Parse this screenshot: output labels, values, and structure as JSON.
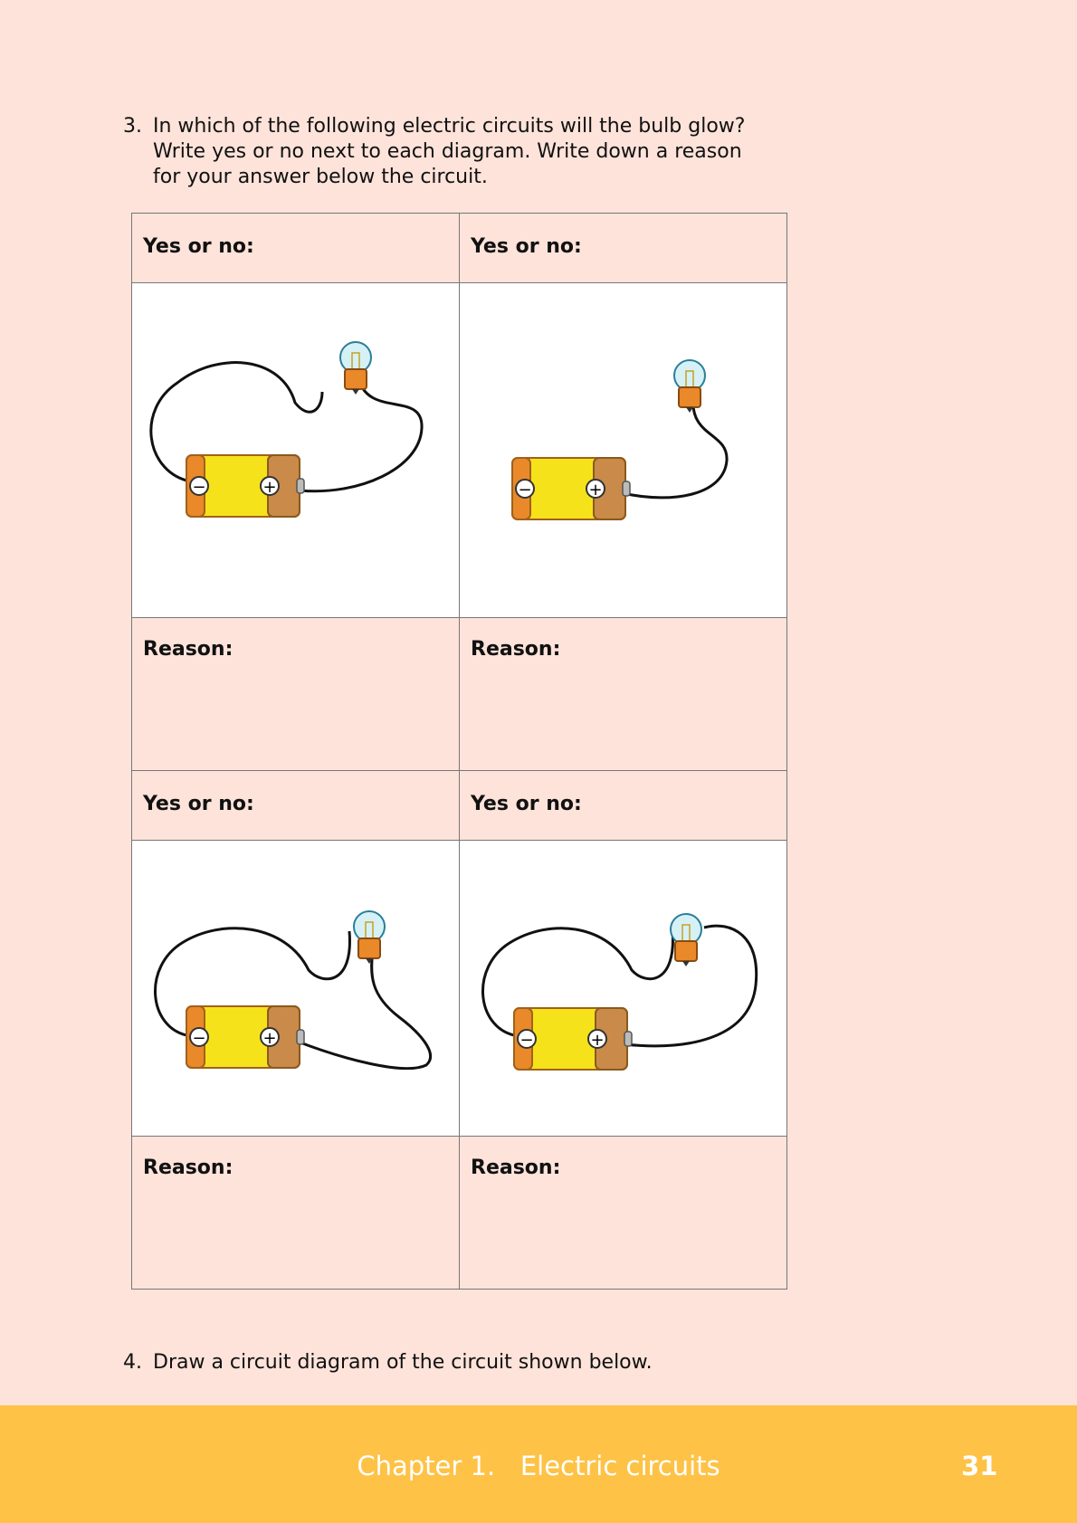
{
  "question3": {
    "number": "3.",
    "lines": [
      "In which of the following electric circuits will the bulb glow?",
      "Write yes or no next to each diagram. Write down a reason",
      "for your answer below the circuit."
    ]
  },
  "table": {
    "yes_no_label": "Yes or no:",
    "reason_label": "Reason:",
    "battery_negative": "−",
    "battery_positive": "+"
  },
  "question4": {
    "number": "4.",
    "text": "Draw a circuit diagram of the circuit shown below."
  },
  "footer": {
    "chapter": "Chapter 1.   Electric circuits",
    "page_number": "31"
  },
  "colors": {
    "page_background": "#fde3da",
    "footer_band": "#fec246",
    "battery_body": "#f6e21a",
    "battery_cap": "#e9892a"
  }
}
